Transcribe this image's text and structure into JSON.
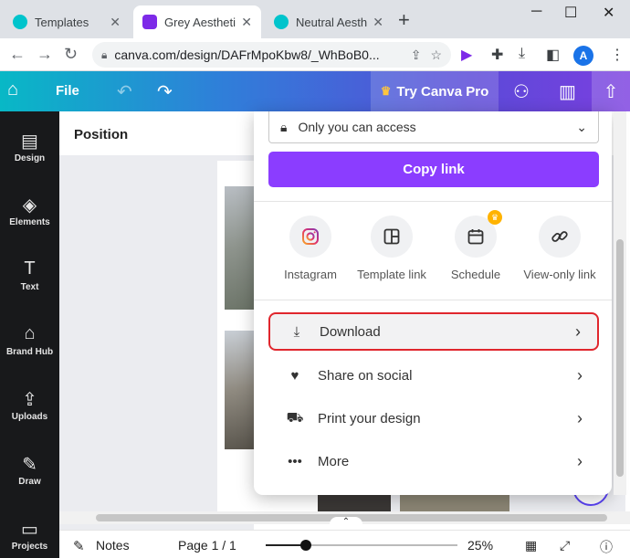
{
  "browser": {
    "tabs": [
      {
        "title": "Templates",
        "color": "#00c4cc",
        "active": false
      },
      {
        "title": "Grey Aesthetic",
        "color": "#7d2ae8",
        "active": true
      },
      {
        "title": "Neutral Aesthe",
        "color": "#00c4cc",
        "active": false
      }
    ],
    "url": "canva.com/design/DAFrMpoKbw8/_WhBoB0...",
    "profile_initial": "A"
  },
  "header": {
    "file_label": "File",
    "try_pro_label": "Try Canva Pro",
    "crown_icon": "crown-icon"
  },
  "sidebar": {
    "items": [
      {
        "label": "Design",
        "icon": "design-icon",
        "glyph": "▤"
      },
      {
        "label": "Elements",
        "icon": "elements-icon",
        "glyph": "◈"
      },
      {
        "label": "Text",
        "icon": "text-icon",
        "glyph": "T"
      },
      {
        "label": "Brand Hub",
        "icon": "brand-hub-icon",
        "glyph": "⌂"
      },
      {
        "label": "Uploads",
        "icon": "uploads-icon",
        "glyph": "⇪"
      },
      {
        "label": "Draw",
        "icon": "draw-icon",
        "glyph": "✎"
      },
      {
        "label": "Projects",
        "icon": "projects-icon",
        "glyph": "▭"
      }
    ]
  },
  "position_panel": {
    "title": "Position"
  },
  "share_menu": {
    "access_value": "Only you can access",
    "copy_link_label": "Copy link",
    "quick_actions": [
      {
        "label": "Instagram",
        "icon": "instagram-icon"
      },
      {
        "label": "Template link",
        "icon": "template-link-icon"
      },
      {
        "label": "Schedule",
        "icon": "calendar-icon",
        "pro": true
      },
      {
        "label": "View-only link",
        "icon": "link-icon"
      }
    ],
    "options": [
      {
        "label": "Download",
        "icon": "download-icon",
        "highlighted": true
      },
      {
        "label": "Share on social",
        "icon": "heart-icon",
        "highlighted": false
      },
      {
        "label": "Print your design",
        "icon": "truck-icon",
        "highlighted": false
      },
      {
        "label": "More",
        "icon": "more-icon",
        "highlighted": false
      }
    ]
  },
  "footer": {
    "notes_label": "Notes",
    "page_label": "Page 1 / 1",
    "zoom_label": "25%",
    "zoom_fraction": 0.25
  },
  "colors": {
    "accent_purple": "#8b3dff",
    "highlight_red": "#e0262d"
  }
}
